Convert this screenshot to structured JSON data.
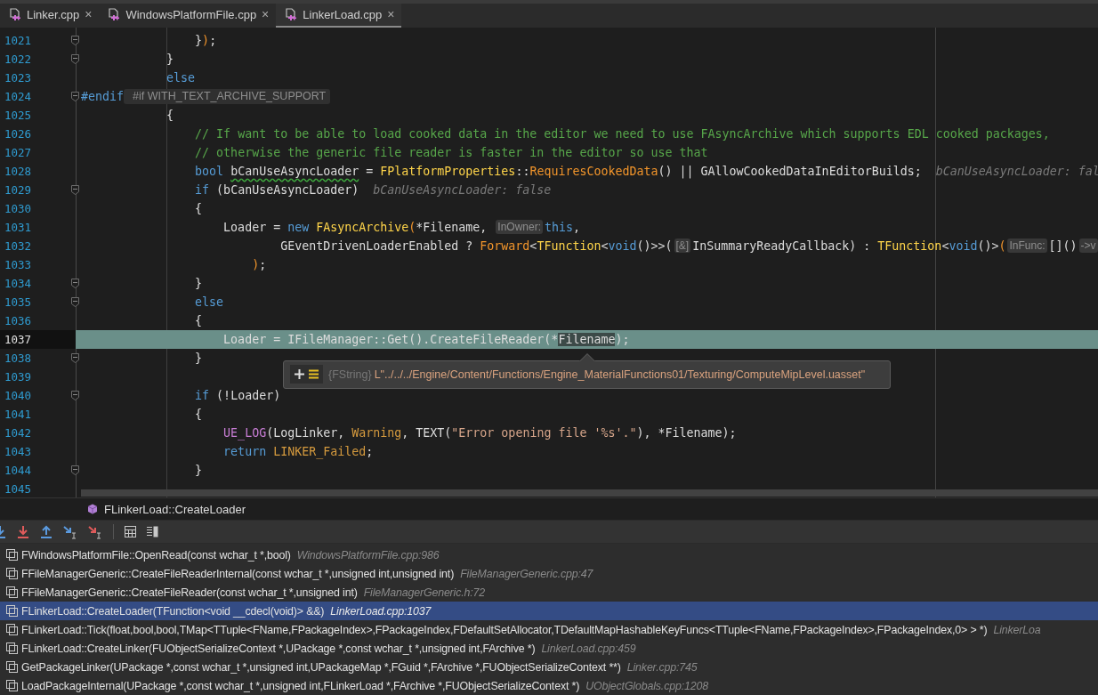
{
  "tabs": [
    {
      "label": "Linker.cpp",
      "close": "×",
      "selected": false
    },
    {
      "label": "WindowsPlatformFile.cpp",
      "close": "×",
      "selected": false
    },
    {
      "label": "LinkerLoad.cpp",
      "close": "×",
      "selected": true
    }
  ],
  "editor": {
    "lines": [
      {
        "number": "1021",
        "fold": true,
        "current": false,
        "tokens": [
          {
            "text": "                }",
            "kind": "plain"
          },
          {
            "text": ")",
            "kind": "paren"
          },
          {
            "text": ";",
            "kind": "plain"
          }
        ]
      },
      {
        "number": "1022",
        "fold": true,
        "current": false,
        "tokens": [
          {
            "text": "            }",
            "kind": "plain"
          }
        ]
      },
      {
        "number": "1023",
        "fold": false,
        "current": false,
        "tokens": [
          {
            "text": "            else",
            "kind": "keyword"
          }
        ]
      },
      {
        "number": "1024",
        "fold": true,
        "current": false,
        "tokens": [
          {
            "text": "#endif",
            "kind": "keyword"
          },
          {
            "text": "#if WITH_TEXT_ARCHIVE_SUPPORT",
            "kind": "fold-chip"
          }
        ]
      },
      {
        "number": "1025",
        "fold": false,
        "current": false,
        "tokens": [
          {
            "text": "            {",
            "kind": "plain"
          }
        ]
      },
      {
        "number": "1026",
        "fold": false,
        "current": false,
        "tokens": [
          {
            "text": "                // If want to be able to load cooked data in the editor we need to use FAsyncArchive which supports EDL cooked packages,",
            "kind": "comment"
          }
        ]
      },
      {
        "number": "1027",
        "fold": false,
        "current": false,
        "tokens": [
          {
            "text": "                // otherwise the generic file reader is faster in the editor so use that",
            "kind": "comment"
          }
        ]
      },
      {
        "number": "1028",
        "fold": false,
        "current": false,
        "tokens": [
          {
            "text": "                bool ",
            "kind": "keyword"
          },
          {
            "text": "bCanUseAsyncLoader",
            "kind": "warning"
          },
          {
            "text": " = ",
            "kind": "plain"
          },
          {
            "text": "FPlatformProperties",
            "kind": "type"
          },
          {
            "text": "::",
            "kind": "plain"
          },
          {
            "text": "RequiresCookedData",
            "kind": "method"
          },
          {
            "text": "() || GAllowCookedDataInEditorBuilds;",
            "kind": "plain"
          },
          {
            "text": "bCanUseAsyncLoader: fal",
            "kind": "value-hint"
          }
        ]
      },
      {
        "number": "1029",
        "fold": true,
        "current": false,
        "tokens": [
          {
            "text": "                if",
            "kind": "keyword"
          },
          {
            "text": " (bCanUseAsyncLoader)",
            "kind": "plain"
          },
          {
            "text": "bCanUseAsyncLoader: false",
            "kind": "value-hint"
          }
        ]
      },
      {
        "number": "1030",
        "fold": false,
        "current": false,
        "tokens": [
          {
            "text": "                {",
            "kind": "plain"
          }
        ]
      },
      {
        "number": "1031",
        "fold": false,
        "current": false,
        "tokens": [
          {
            "text": "                    Loader = ",
            "kind": "plain"
          },
          {
            "text": "new ",
            "kind": "keyword"
          },
          {
            "text": "FAsyncArchive",
            "kind": "type"
          },
          {
            "text": "(",
            "kind": "paren"
          },
          {
            "text": "*Filename, ",
            "kind": "plain"
          },
          {
            "text": "InOwner:",
            "kind": "chip"
          },
          {
            "text": "this",
            "kind": "keyword"
          },
          {
            "text": ",",
            "kind": "plain"
          }
        ]
      },
      {
        "number": "1032",
        "fold": false,
        "current": false,
        "tokens": [
          {
            "text": "                            GEventDrivenLoaderEnabled ? ",
            "kind": "plain"
          },
          {
            "text": "Forward",
            "kind": "method"
          },
          {
            "text": "<",
            "kind": "plain"
          },
          {
            "text": "TFunction",
            "kind": "type"
          },
          {
            "text": "<",
            "kind": "plain"
          },
          {
            "text": "void",
            "kind": "keyword"
          },
          {
            "text": "()>>(",
            "kind": "plain"
          },
          {
            "text": "[&]",
            "kind": "chip"
          },
          {
            "text": "InSummaryReadyCallback) : ",
            "kind": "plain"
          },
          {
            "text": "TFunction",
            "kind": "type"
          },
          {
            "text": "<",
            "kind": "plain"
          },
          {
            "text": "void",
            "kind": "keyword"
          },
          {
            "text": "()>",
            "kind": "plain"
          },
          {
            "text": "(",
            "kind": "paren"
          },
          {
            "text": "InFunc:",
            "kind": "chip"
          },
          {
            "text": "[]()",
            "kind": "plain"
          },
          {
            "text": "->v",
            "kind": "chip"
          }
        ]
      },
      {
        "number": "1033",
        "fold": false,
        "current": false,
        "tokens": [
          {
            "text": "                        )",
            "kind": "paren"
          },
          {
            "text": ";",
            "kind": "plain"
          }
        ]
      },
      {
        "number": "1034",
        "fold": true,
        "current": false,
        "tokens": [
          {
            "text": "                }",
            "kind": "plain"
          }
        ]
      },
      {
        "number": "1035",
        "fold": true,
        "current": false,
        "tokens": [
          {
            "text": "                else",
            "kind": "keyword"
          }
        ]
      },
      {
        "number": "1036",
        "fold": false,
        "current": false,
        "tokens": [
          {
            "text": "                {",
            "kind": "plain"
          }
        ]
      },
      {
        "number": "1037",
        "fold": false,
        "current": true,
        "tokens": [
          {
            "text": "                    Loader = IFileManager::Get().CreateFileReader(*",
            "kind": "plain"
          },
          {
            "text": "Filename",
            "kind": "selected"
          },
          {
            "text": ");",
            "kind": "plain"
          }
        ]
      },
      {
        "number": "1038",
        "fold": true,
        "current": false,
        "tokens": [
          {
            "text": "                }",
            "kind": "plain"
          }
        ]
      },
      {
        "number": "1039",
        "fold": false,
        "current": false
      },
      {
        "number": "1040",
        "fold": true,
        "current": false,
        "tokens": [
          {
            "text": "                if",
            "kind": "keyword"
          },
          {
            "text": " (!Loader)",
            "kind": "plain"
          }
        ]
      },
      {
        "number": "1041",
        "fold": false,
        "current": false,
        "tokens": [
          {
            "text": "                {",
            "kind": "plain"
          }
        ]
      },
      {
        "number": "1042",
        "fold": false,
        "current": false,
        "tokens": [
          {
            "text": "                    UE_LOG",
            "kind": "macro"
          },
          {
            "text": "(LogLinker, ",
            "kind": "plain"
          },
          {
            "text": "Warning",
            "kind": "enum"
          },
          {
            "text": ", TEXT(",
            "kind": "plain"
          },
          {
            "text": "\"Error opening file '%s'.\"",
            "kind": "string"
          },
          {
            "text": "), *Filename);",
            "kind": "plain"
          }
        ]
      },
      {
        "number": "1043",
        "fold": false,
        "current": false,
        "tokens": [
          {
            "text": "                    return ",
            "kind": "keyword"
          },
          {
            "text": "LINKER_Failed",
            "kind": "enum"
          },
          {
            "text": ";",
            "kind": "plain"
          }
        ]
      },
      {
        "number": "1044",
        "fold": true,
        "current": false,
        "tokens": [
          {
            "text": "                }",
            "kind": "plain"
          }
        ]
      },
      {
        "number": "1045",
        "fold": false,
        "current": false
      }
    ],
    "tooltip": {
      "type": "{FString}",
      "value": "L\"../../../Engine/Content/Functions/Engine_MaterialFunctions01/Texturing/ComputeMipLevel.uasset\""
    }
  },
  "breadcrumb": "FLinkerLoad::CreateLoader",
  "callstack": [
    {
      "function": "FWindowsPlatformFile::OpenRead(const wchar_t *,bool)",
      "location": "WindowsPlatformFile.cpp:986",
      "selected": false
    },
    {
      "function": "FFileManagerGeneric::CreateFileReaderInternal(const wchar_t *,unsigned int,unsigned int)",
      "location": "FileManagerGeneric.cpp:47",
      "selected": false
    },
    {
      "function": "FFileManagerGeneric::CreateFileReader(const wchar_t *,unsigned int)",
      "location": "FileManagerGeneric.h:72",
      "selected": false
    },
    {
      "function": "FLinkerLoad::CreateLoader(TFunction<void __cdecl(void)> &&)",
      "location": "LinkerLoad.cpp:1037",
      "selected": true
    },
    {
      "function": "FLinkerLoad::Tick(float,bool,bool,TMap<TTuple<FName,FPackageIndex>,FPackageIndex,FDefaultSetAllocator,TDefaultMapHashableKeyFuncs<TTuple<FName,FPackageIndex>,FPackageIndex,0> > *)",
      "location": "LinkerLoa",
      "selected": false
    },
    {
      "function": "FLinkerLoad::CreateLinker(FUObjectSerializeContext *,UPackage *,const wchar_t *,unsigned int,FArchive *)",
      "location": "LinkerLoad.cpp:459",
      "selected": false
    },
    {
      "function": "GetPackageLinker(UPackage *,const wchar_t *,unsigned int,UPackageMap *,FGuid *,FArchive *,FUObjectSerializeContext **)",
      "location": "Linker.cpp:745",
      "selected": false
    },
    {
      "function": "LoadPackageInternal(UPackage *,const wchar_t *,unsigned int,FLinkerLoad *,FArchive *,FUObjectSerializeContext *)",
      "location": "UObjectGlobals.cpp:1208",
      "selected": false
    }
  ]
}
